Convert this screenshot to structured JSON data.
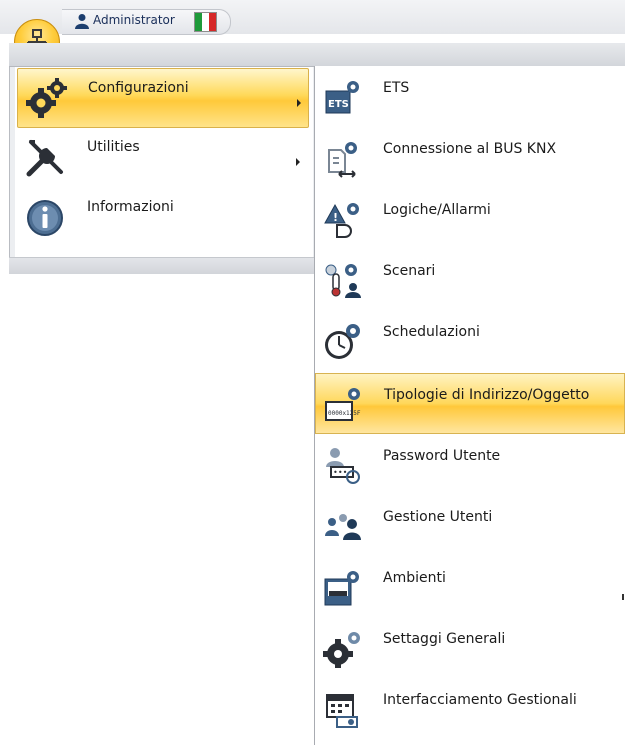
{
  "topbar": {
    "user_name": "Administrator",
    "flag_colors": [
      "#1e9a3a",
      "#ffffff",
      "#d62828"
    ]
  },
  "app_button": {
    "icon": "network-tree-icon"
  },
  "main_menu": {
    "items": [
      {
        "label": "Configurazioni",
        "icon": "gears-icon",
        "has_submenu": true,
        "selected": true
      },
      {
        "label": "Utilities",
        "icon": "tools-icon",
        "has_submenu": true,
        "selected": false
      },
      {
        "label": "Informazioni",
        "icon": "info-icon",
        "has_submenu": false,
        "selected": false
      }
    ]
  },
  "submenu": {
    "items": [
      {
        "label": "ETS",
        "icon": "ets-icon"
      },
      {
        "label": "Connessione al BUS KNX",
        "icon": "bus-connection-icon"
      },
      {
        "label": "Logiche/Allarmi",
        "icon": "logic-alarm-icon"
      },
      {
        "label": "Scenari",
        "icon": "scenes-icon"
      },
      {
        "label": "Schedulazioni",
        "icon": "scheduling-clock-icon"
      },
      {
        "label": "Tipologie di Indirizzo/Oggetto",
        "icon": "address-type-icon",
        "selected": true,
        "icon_text": "0000x125F"
      },
      {
        "label": "Password Utente",
        "icon": "user-password-icon"
      },
      {
        "label": "Gestione Utenti",
        "icon": "users-management-icon"
      },
      {
        "label": "Ambienti",
        "icon": "rooms-icon"
      },
      {
        "label": "Settaggi Generali",
        "icon": "general-settings-icon"
      },
      {
        "label": "Interfacciamento Gestionali",
        "icon": "management-interface-icon"
      }
    ]
  },
  "colors": {
    "accent_selected": "#ffd75a",
    "icon_blue": "#3b5f86",
    "icon_dark": "#2b2f36"
  }
}
